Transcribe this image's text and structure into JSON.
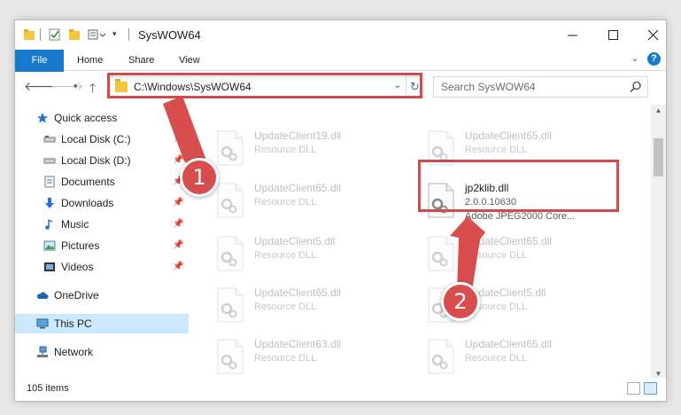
{
  "window": {
    "title": "SysWOW64"
  },
  "ribbon": {
    "tabs": [
      "File",
      "Home",
      "Share",
      "View"
    ],
    "help_glyph": "?"
  },
  "address": {
    "path": "C:\\Windows\\SysWOW64",
    "search_placeholder": "Search SysWOW64"
  },
  "nav": {
    "items": [
      {
        "label": "Quick access",
        "icon": "star-icon"
      },
      {
        "label": "Local Disk (C:)",
        "icon": "drive-icon",
        "pinned": true
      },
      {
        "label": "Local Disk (D:)",
        "icon": "drive-icon",
        "pinned": true
      },
      {
        "label": "Documents",
        "icon": "documents-icon",
        "pinned": true
      },
      {
        "label": "Downloads",
        "icon": "downloads-icon",
        "pinned": true
      },
      {
        "label": "Music",
        "icon": "music-icon",
        "pinned": true
      },
      {
        "label": "Pictures",
        "icon": "pictures-icon",
        "pinned": true
      },
      {
        "label": "Videos",
        "icon": "videos-icon",
        "pinned": true
      },
      {
        "label": "OneDrive",
        "icon": "cloud-icon"
      },
      {
        "label": "This PC",
        "icon": "computer-icon",
        "selected": true
      },
      {
        "label": "Network",
        "icon": "network-icon"
      }
    ]
  },
  "files": [
    {
      "name": "UpdateClient19.dll",
      "type": "Resource DLL"
    },
    {
      "name": "UpdateClient65.dll",
      "type": "Resource DLL"
    },
    {
      "name": "UpdateClient65.dll",
      "type": "Resource DLL"
    },
    {
      "name": "jp2klib.dll",
      "version": "2.0.0.10630",
      "type": "Adobe JPEG2000 Core...",
      "highlighted": true
    },
    {
      "name": "UpdateClient5.dll",
      "type": "Resource DLL"
    },
    {
      "name": "UpdateClient65.dll",
      "type": "Resource DLL"
    },
    {
      "name": "UpdateClient65.dll",
      "type": "Resource DLL"
    },
    {
      "name": "UpdateClient5.dll",
      "type": "Resource DLL"
    },
    {
      "name": "UpdateClient63.dll",
      "type": "Resource DLL"
    },
    {
      "name": "UpdateClient65.dll",
      "type": "Resource DLL"
    }
  ],
  "status": {
    "item_count": "105 items"
  },
  "annotations": {
    "badge1": "1",
    "badge2": "2",
    "color": "#d14a4a"
  },
  "colors": {
    "accent": "#1979ca",
    "selected_bg": "#cce8ff"
  }
}
